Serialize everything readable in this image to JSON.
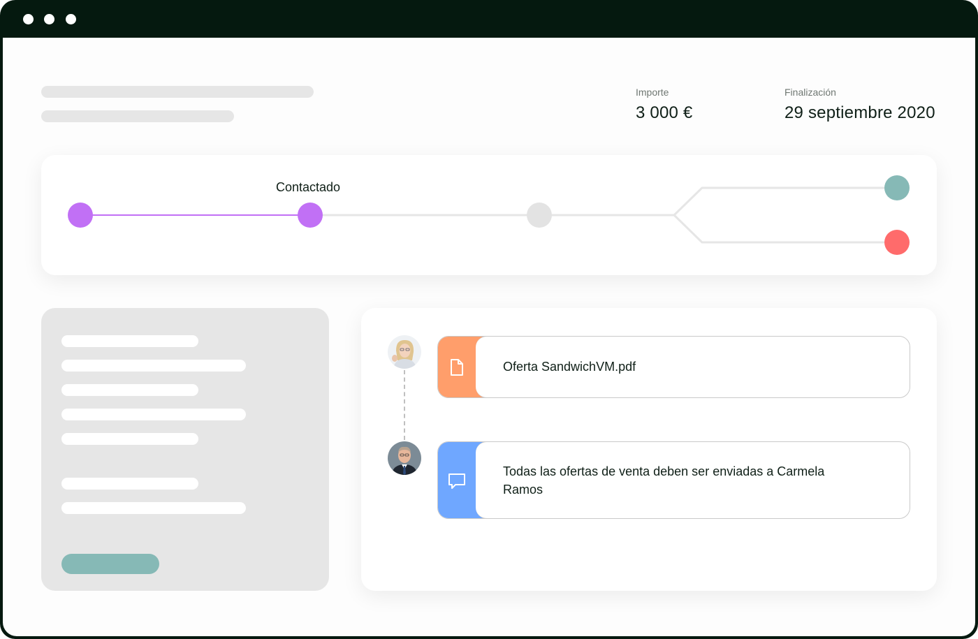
{
  "window": {
    "controls": [
      "close-dot",
      "minimize-dot",
      "maximize-dot"
    ]
  },
  "header": {
    "amount_label": "Importe",
    "amount_value": "3 000 €",
    "end_label": "Finalización",
    "end_value": "29 septiembre 2020"
  },
  "pipeline": {
    "current_stage_label": "Contactado",
    "colors": {
      "done": "#c170f5",
      "pending": "#e3e3e3",
      "won": "#86b9b6",
      "lost": "#ff6b6b"
    }
  },
  "timeline": {
    "items": [
      {
        "type": "file",
        "icon": "document-icon",
        "accent": "#ff9e6b",
        "text": "Oferta  SandwichVM.pdf"
      },
      {
        "type": "comment",
        "icon": "chat-bubble-icon",
        "accent": "#6fa7ff",
        "text_line1": "Todas las ofertas de venta deben ser enviadas a Carmela",
        "text_line2": "Ramos"
      }
    ]
  }
}
